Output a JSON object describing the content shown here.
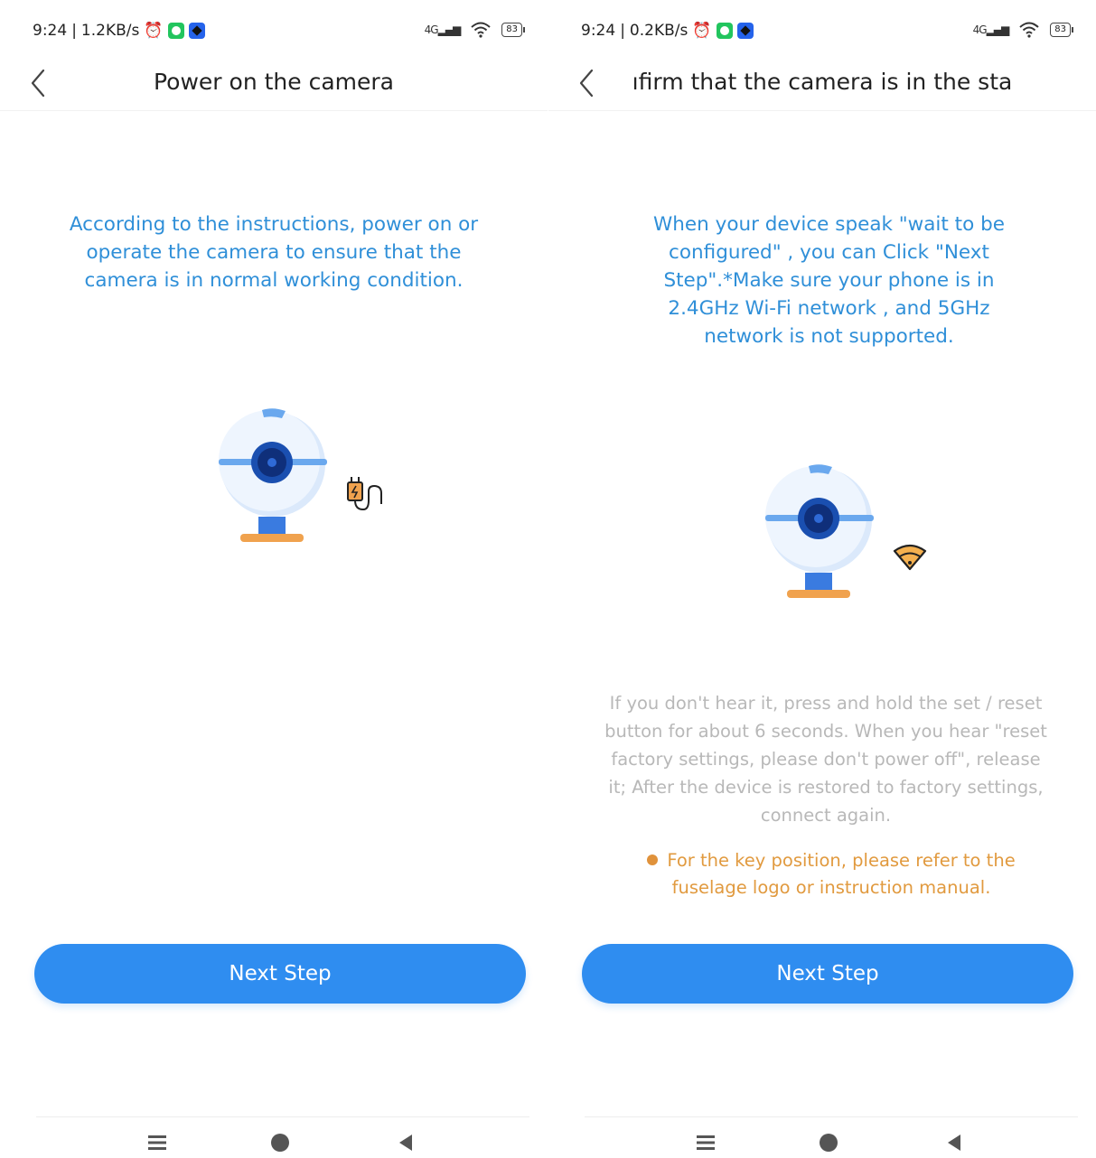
{
  "screens": [
    {
      "status": {
        "time": "9:24",
        "speed": "1.2KB/s",
        "battery": "83",
        "network": "4G"
      },
      "nav": {
        "title": "Power on the camera"
      },
      "instruction": "According to the instructions, power on or operate the camera to ensure that the camera is in normal working condition.",
      "illustration": {
        "camera": "webcam-illustration",
        "badge": "power-plug-icon"
      },
      "next_button": "Next Step"
    },
    {
      "status": {
        "time": "9:24",
        "speed": "0.2KB/s",
        "battery": "83",
        "network": "4G"
      },
      "nav": {
        "title": "ıfirm that the camera is in the sta"
      },
      "instruction": "When your device speak \"wait to be configured\" , you can Click \"Next Step\".*Make sure your phone is in 2.4GHz Wi-Fi network , and 5GHz network is not supported.",
      "illustration": {
        "camera": "webcam-illustration",
        "badge": "wifi-icon"
      },
      "reset_hint": "If you don't hear it, press and hold the set / reset button for about 6 seconds. When you hear \"reset factory settings, please don't power off\", release it; After the device is restored to factory settings, connect again.",
      "key_hint": "For the key position, please refer to the fuselage logo or instruction manual.",
      "next_button": "Next Step"
    }
  ],
  "colors": {
    "accent": "#2f8df0",
    "instruction_text": "#2f8fd8",
    "grey_text": "#b8b8b8",
    "orange_text": "#e19a3f",
    "camera_blue": "#1f5fbf",
    "camera_stand": "#f0a24e"
  }
}
